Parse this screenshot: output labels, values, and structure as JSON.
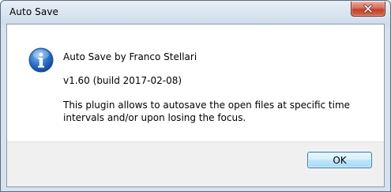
{
  "window": {
    "title": "Auto Save"
  },
  "dialog": {
    "icon": "information-icon",
    "title_line": "Auto Save by Franco Stellari",
    "version_line": "v1.60 (build 2017-02-08)",
    "description": "This plugin allows to autosave the open files at specific time intervals and/or upon losing the focus."
  },
  "buttons": {
    "ok_label": "OK"
  },
  "colors": {
    "close_button": "#c8452f",
    "info_icon": "#2f67b8",
    "ok_button_border": "#3c7fb1"
  }
}
